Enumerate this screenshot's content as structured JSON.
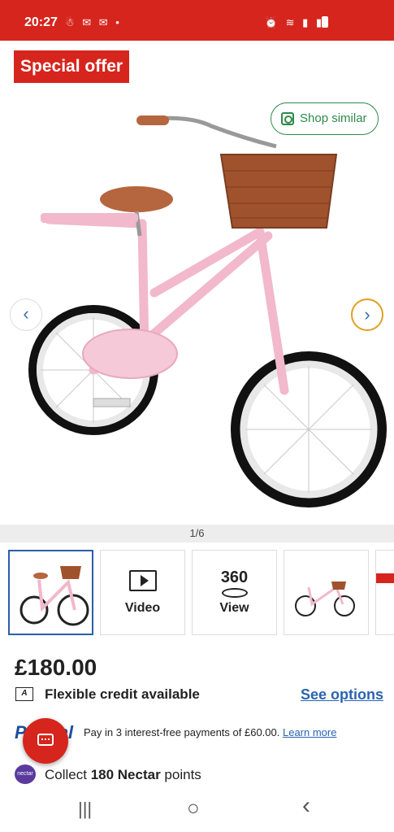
{
  "status_bar": {
    "time": "20:27",
    "left_icons": "☃ ✉ ✉ •",
    "right_icons": "⏰ ≋ ▮ ▮"
  },
  "gallery": {
    "badge": "Special offer",
    "shop_similar": "Shop similar",
    "counter": "1/6",
    "prev_icon": "chevron-left-icon",
    "next_icon": "chevron-right-icon"
  },
  "thumbnails": [
    {
      "kind": "image",
      "caption": ""
    },
    {
      "kind": "video",
      "caption": "Video"
    },
    {
      "kind": "360",
      "caption_top": "360",
      "caption": "View"
    },
    {
      "kind": "image",
      "caption": ""
    },
    {
      "kind": "image",
      "caption": ""
    }
  ],
  "product": {
    "price": "£180.00",
    "credit_label": "Flexible credit available",
    "see_options": "See options",
    "paypal_brand": "PayPal",
    "paypal_text": "Pay in 3 interest-free payments of £60.00.",
    "learn_more": "Learn more",
    "nectar_prefix": "Collect ",
    "nectar_points": "180 Nectar",
    "nectar_suffix": " points",
    "nectar_logo": "nectar"
  },
  "colors": {
    "brand_red": "#d6251d",
    "link_blue": "#2a64b0",
    "shop_green": "#2f8a4a",
    "bike_pink": "#f2c7d6"
  },
  "navbar": {
    "recent": "|||",
    "home": "○",
    "back": "‹"
  }
}
